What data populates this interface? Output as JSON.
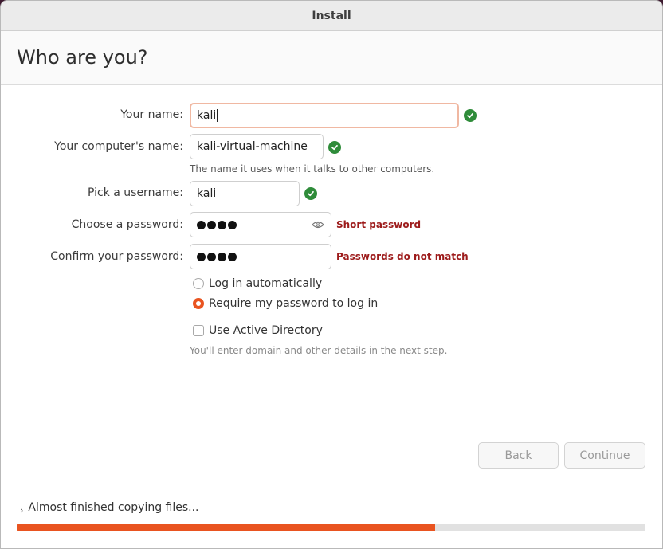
{
  "window": {
    "title": "Install"
  },
  "page": {
    "heading": "Who are you?"
  },
  "form": {
    "name_label": "Your name:",
    "name_value": "kali",
    "computer_label": "Your computer's name:",
    "computer_value": "kali-virtual-machine",
    "computer_hint": "The name it uses when it talks to other computers.",
    "username_label": "Pick a username:",
    "username_value": "kali",
    "password_label": "Choose a password:",
    "password_error": "Short password",
    "confirm_label": "Confirm your password:",
    "confirm_error": "Passwords do not match",
    "login_auto_label": "Log in automatically",
    "require_password_label": "Require my password to log in",
    "selected_login_option": "require_password",
    "active_directory_label": "Use Active Directory",
    "active_directory_checked": false,
    "active_directory_hint": "You'll enter domain and other details in the next step."
  },
  "buttons": {
    "back": "Back",
    "continue": "Continue"
  },
  "status": {
    "text": "Almost finished copying files...",
    "progress": 0.665
  },
  "colors": {
    "accent": "#e95420",
    "success": "#2f8c3a",
    "error": "#9d1b1b"
  },
  "icons": {
    "valid": "check-circle-icon",
    "reveal": "eye-icon",
    "expander": "chevron-right-icon"
  }
}
